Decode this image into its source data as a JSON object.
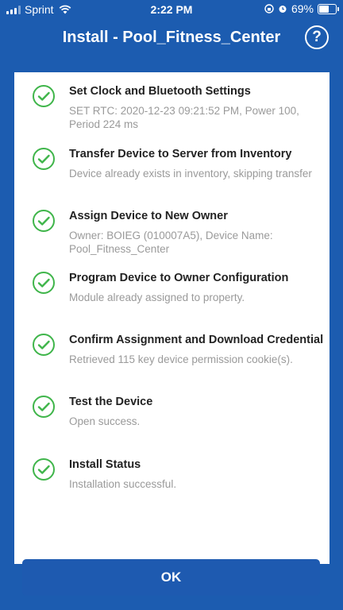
{
  "status_bar": {
    "carrier": "Sprint",
    "time": "2:22 PM",
    "battery": "69%",
    "battery_level": 0.69
  },
  "header": {
    "title": "Install - Pool_Fitness_Center",
    "help_label": "?"
  },
  "steps": [
    {
      "title": "Set Clock and Bluetooth Settings",
      "detail": "SET RTC: 2020-12-23 09:21:52 PM, Power 100, Period 224 ms",
      "status": "complete",
      "icon": "check-circle-icon"
    },
    {
      "title": "Transfer Device to Server from Inventory",
      "detail": "Device already exists in inventory, skipping transfer",
      "status": "complete",
      "icon": "check-circle-icon"
    },
    {
      "title": "Assign Device to New Owner",
      "detail": "Owner: BOIEG (010007A5), Device Name: Pool_Fitness_Center",
      "status": "complete",
      "icon": "check-circle-icon"
    },
    {
      "title": "Program Device to Owner Configuration",
      "detail": "Module already assigned to property.",
      "status": "complete",
      "icon": "check-circle-icon"
    },
    {
      "title": "Confirm Assignment and Download Credential",
      "detail": "Retrieved 115 key device permission cookie(s).",
      "status": "complete",
      "icon": "check-circle-icon"
    },
    {
      "title": "Test the Device",
      "detail": "Open success.",
      "status": "complete",
      "icon": "check-circle-icon"
    },
    {
      "title": "Install Status",
      "detail": "Installation successful.",
      "status": "complete",
      "icon": "check-circle-icon"
    }
  ],
  "ok_button": {
    "label": "OK"
  },
  "colors": {
    "primary": "#1c5cb0",
    "success": "#3fb54a",
    "title_text": "#222222",
    "detail_text": "#9a9a9a"
  }
}
